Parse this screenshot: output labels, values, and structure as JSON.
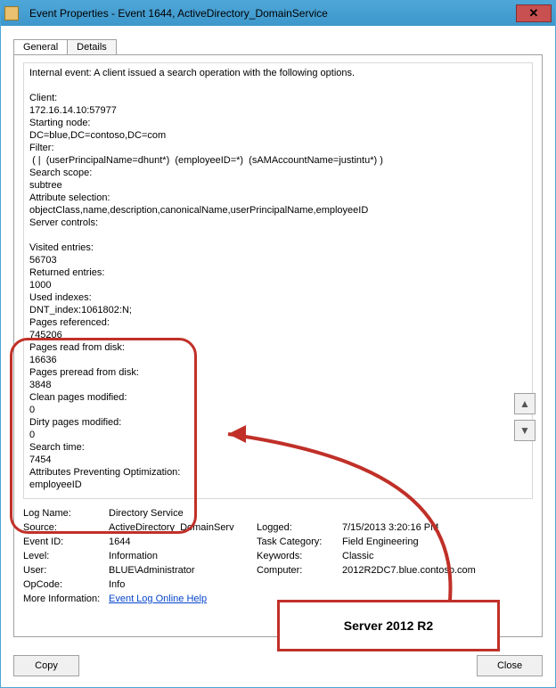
{
  "window": {
    "title": "Event Properties - Event 1644, ActiveDirectory_DomainService"
  },
  "tabs": {
    "general": "General",
    "details": "Details"
  },
  "description": "Internal event: A client issued a search operation with the following options.\n\nClient:\n172.16.14.10:57977\nStarting node:\nDC=blue,DC=contoso,DC=com\nFilter:\n ( |  (userPrincipalName=dhunt*)  (employeeID=*)  (sAMAccountName=justintu*) )\nSearch scope:\nsubtree\nAttribute selection:\nobjectClass,name,description,canonicalName,userPrincipalName,employeeID\nServer controls:\n\nVisited entries:\n56703\nReturned entries:\n1000\nUsed indexes:\nDNT_index:1061802:N;\nPages referenced:\n745206\nPages read from disk:\n16636\nPages preread from disk:\n3848\nClean pages modified:\n0\nDirty pages modified:\n0\nSearch time:\n7454\nAttributes Preventing Optimization:\nemployeeID\n",
  "meta": {
    "labels": {
      "logName": "Log Name:",
      "source": "Source:",
      "eventId": "Event ID:",
      "level": "Level:",
      "user": "User:",
      "opCode": "OpCode:",
      "moreInfo": "More Information:",
      "logged": "Logged:",
      "taskCategory": "Task Category:",
      "keywords": "Keywords:",
      "computer": "Computer:"
    },
    "values": {
      "logName": "Directory Service",
      "source": "ActiveDirectory_DomainServ",
      "eventId": "1644",
      "level": "Information",
      "user": "BLUE\\Administrator",
      "opCode": "Info",
      "moreInfo": "Event Log Online Help",
      "logged": "7/15/2013 3:20:16 PM",
      "taskCategory": "Field Engineering",
      "keywords": "Classic",
      "computer": "2012R2DC7.blue.contoso.com"
    }
  },
  "buttons": {
    "copy": "Copy",
    "close": "Close"
  },
  "annotation": {
    "label": "Server 2012 R2"
  }
}
